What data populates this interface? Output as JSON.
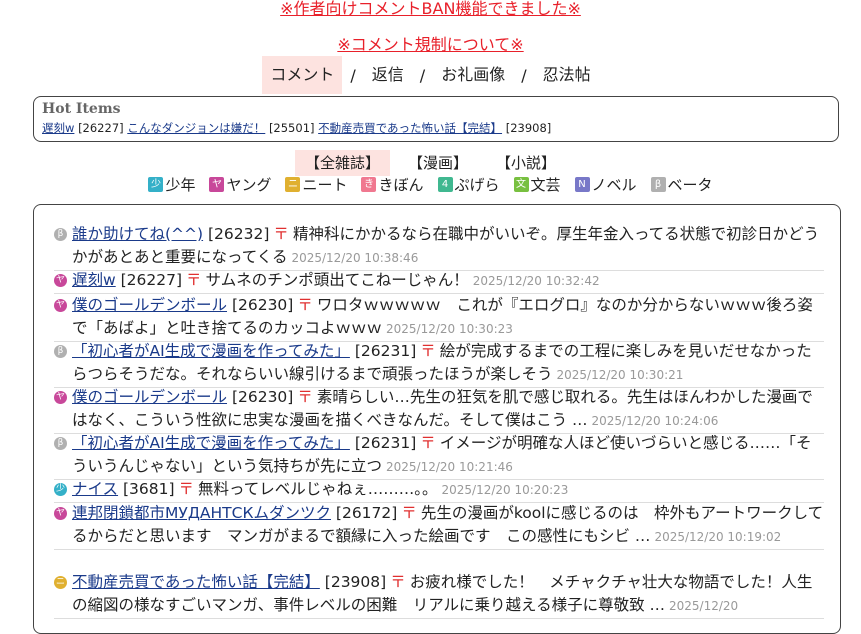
{
  "top_notice": "※作者向けコメントBAN機能できました※",
  "regulation_link": "※コメント規制について※",
  "main_tabs": [
    "コメント",
    "返信",
    "お礼画像",
    "忍法帖"
  ],
  "hot": {
    "title": "Hot Items",
    "items": [
      {
        "title": "遅刻w",
        "id": "[26227]"
      },
      {
        "title": "こんなダンジョンは嫌だ！",
        "id": "[25501]"
      },
      {
        "title": "不動産売買であった怖い話【完結】",
        "id": "[23908]"
      }
    ]
  },
  "categories": [
    "【全雑誌】",
    "【漫画】",
    "【小説】"
  ],
  "genres": [
    {
      "label": "少年",
      "glyph": "少",
      "color": "#34b0c8"
    },
    {
      "label": "ヤング",
      "glyph": "ヤ",
      "color": "#c8489a"
    },
    {
      "label": "ニート",
      "glyph": "ニ",
      "color": "#e0b030"
    },
    {
      "label": "きぼん",
      "glyph": "き",
      "color": "#f07890"
    },
    {
      "label": "ぷげら",
      "glyph": "4",
      "color": "#40b890"
    },
    {
      "label": "文芸",
      "glyph": "文",
      "color": "#78c040"
    },
    {
      "label": "ノベル",
      "glyph": "N",
      "color": "#7878c8"
    },
    {
      "label": "ベータ",
      "glyph": "β",
      "color": "#b0b0b0"
    }
  ],
  "comments": [
    {
      "glyph": "β",
      "color": "#b0b0b0",
      "title": "誰か助けてね(^^)",
      "id": "[26232]",
      "mark": "〒",
      "text": "精神科にかかるなら在職中がいいぞ。厚生年金入ってる状態で初診日かどうかがあとあと重要になってくる",
      "time": "2025/12/20 10:38:46"
    },
    {
      "glyph": "ヤ",
      "color": "#c8489a",
      "title": "遅刻w",
      "id": "[26227]",
      "mark": "〒",
      "text": "サムネのチンポ頭出てこねーじゃん！",
      "time": "2025/12/20 10:32:42"
    },
    {
      "glyph": "ヤ",
      "color": "#c8489a",
      "title": "僕のゴールデンボール",
      "id": "[26230]",
      "mark": "〒",
      "text": "ワロタｗｗｗｗｗ　これが『エログロ』なのか分からないｗｗｗ後ろ姿で「あばよ」と吐き捨てるのカッコよｗｗｗ",
      "time": "2025/12/20 10:30:23"
    },
    {
      "glyph": "β",
      "color": "#b0b0b0",
      "title": "「初心者がAI生成で漫画を作ってみた」",
      "id": "[26231]",
      "mark": "〒",
      "text": "絵が完成するまでの工程に楽しみを見いだせなかったらつらそうだな。それならいい線引けるまで頑張ったほうが楽しそう",
      "time": "2025/12/20 10:30:21"
    },
    {
      "glyph": "ヤ",
      "color": "#c8489a",
      "title": "僕のゴールデンボール",
      "id": "[26230]",
      "mark": "〒",
      "text": "素晴らしい…先生の狂気を肌で感じ取れる。先生はほんわかした漫画ではなく、こういう性欲に忠実な漫画を描くべきなんだ。そして僕はこう …",
      "time": "2025/12/20 10:24:06"
    },
    {
      "glyph": "β",
      "color": "#b0b0b0",
      "title": "「初心者がAI生成で漫画を作ってみた」",
      "id": "[26231]",
      "mark": "〒",
      "text": "イメージが明確な人ほど使いづらいと感じる……「そういうんじゃない」という気持ちが先に立つ",
      "time": "2025/12/20 10:21:46"
    },
    {
      "glyph": "少",
      "color": "#34b0c8",
      "title": "ナイス",
      "id": "[3681]",
      "mark": "〒",
      "text": "無料ってレベルじゃねぇ………。。",
      "time": "2025/12/20 10:20:23"
    },
    {
      "glyph": "ヤ",
      "color": "#c8489a",
      "title": "連邦閉鎖都市МУДАНТСКムダンツク",
      "id": "[26172]",
      "mark": "〒",
      "text": "先生の漫画がkoolに感じるのは　枠外もアートワークしてるからだと思います　マンガがまるで額縁に入った絵画です　この感性にもシビ …",
      "time": "2025/12/20 10:19:02"
    },
    {
      "glyph": "ニ",
      "color": "#e0b030",
      "title": "不動産売買であった怖い話【完結】",
      "id": "[23908]",
      "mark": "〒",
      "text": "お疲れ様でした！　メチャクチャ壮大な物語でした！人生の縮図の様なすごいマンガ、事件レベルの困難　リアルに乗り越える様子に尊敬致 …",
      "time": "2025/12/20"
    }
  ]
}
